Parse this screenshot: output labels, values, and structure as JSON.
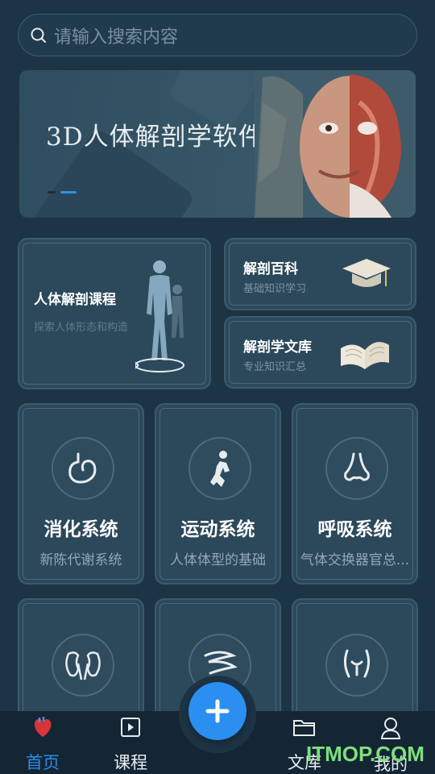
{
  "search": {
    "placeholder": "请输入搜索内容",
    "icon": "search-icon"
  },
  "banner": {
    "title": "3D人体解剖学软件",
    "active_dot": 2,
    "dot_count": 2
  },
  "features": {
    "course": {
      "title": "人体解剖课程",
      "subtitle": "探索人体形态和构造",
      "icon": "human-body-icon"
    },
    "encyclopedia": {
      "title": "解剖百科",
      "subtitle": "基础知识学习",
      "icon": "graduation-cap-icon"
    },
    "library": {
      "title": "解剖学文库",
      "subtitle": "专业知识汇总",
      "icon": "open-book-icon"
    }
  },
  "systems": [
    {
      "title": "消化系统",
      "subtitle": "新陈代谢系统",
      "icon": "stomach-icon"
    },
    {
      "title": "运动系统",
      "subtitle": "人体体型的基础",
      "icon": "runner-icon"
    },
    {
      "title": "呼吸系统",
      "subtitle": "气体交换器官总...",
      "icon": "nose-icon"
    },
    {
      "title": "",
      "subtitle": "",
      "icon": "kidney-icon"
    },
    {
      "title": "",
      "subtitle": "",
      "icon": "intestine-icon"
    },
    {
      "title": "",
      "subtitle": "",
      "icon": "pelvis-icon"
    }
  ],
  "nav": {
    "home": "首页",
    "course": "课程",
    "library": "文库",
    "mine": "我的",
    "add": "add-icon"
  },
  "watermark": "ITMOP.COM",
  "colors": {
    "accent": "#2a8ff0",
    "background": "#1d3445",
    "watermark": "#7ee07c"
  }
}
